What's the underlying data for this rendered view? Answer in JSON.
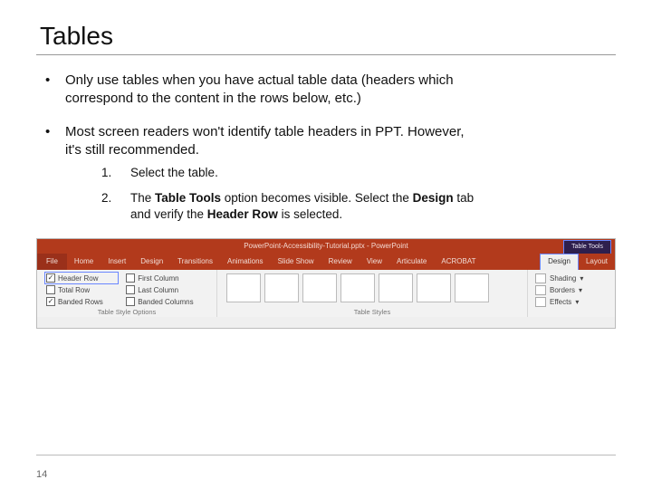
{
  "title": "Tables",
  "bullets": [
    "Only use tables when you have actual table data (headers which correspond to the content in the rows below, etc.)",
    "Most screen readers won't identify table headers in PPT. However, it's still recommended."
  ],
  "steps": {
    "s1": "Select the table.",
    "s2_pre": "The ",
    "s2_b1": "Table Tools",
    "s2_mid1": " option becomes visible. Select the ",
    "s2_b2": "Design",
    "s2_mid2": " tab and verify the ",
    "s2_b3": "Header Row",
    "s2_post": " is selected."
  },
  "ribbon": {
    "titlebar": "PowerPoint-Accessibility-Tutorial.pptx - PowerPoint",
    "tool_tabs_label": "Table Tools",
    "tabs": {
      "file": "File",
      "home": "Home",
      "insert": "Insert",
      "design_main": "Design",
      "transitions": "Transitions",
      "animations": "Animations",
      "slideshow": "Slide Show",
      "review": "Review",
      "view": "View",
      "articulate": "Articulate",
      "acrobat": "ACROBAT",
      "design": "Design",
      "layout": "Layout"
    },
    "style_options": {
      "group_label": "Table Style Options",
      "header_row": "Header Row",
      "total_row": "Total Row",
      "banded_rows": "Banded Rows",
      "first_col": "First Column",
      "last_col": "Last Column",
      "banded_cols": "Banded Columns"
    },
    "styles_group_label": "Table Styles",
    "right": {
      "shading": "Shading",
      "borders": "Borders",
      "effects": "Effects"
    }
  },
  "page_number": "14"
}
